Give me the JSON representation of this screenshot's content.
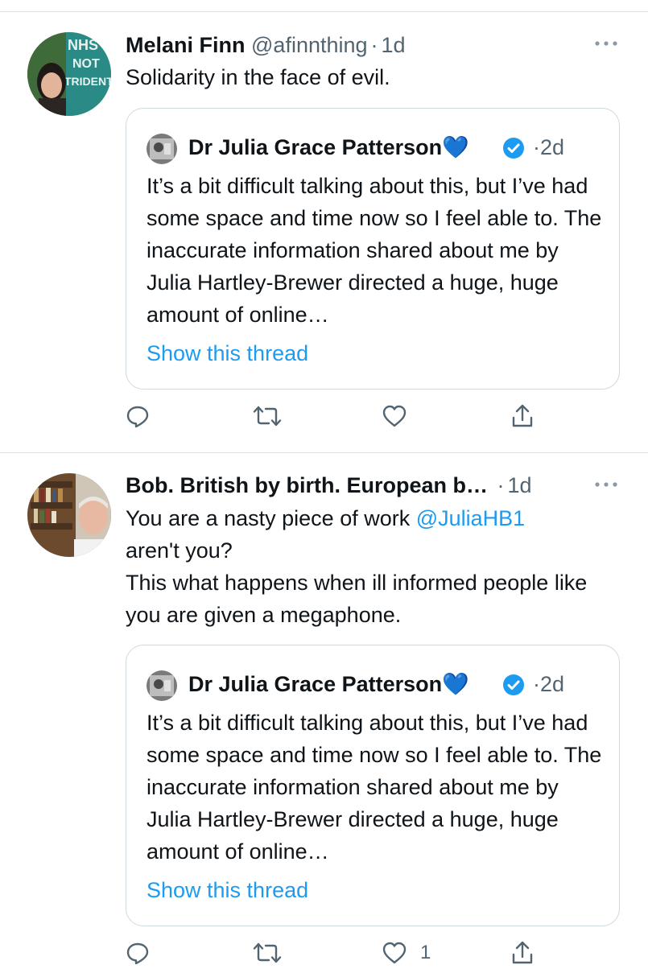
{
  "tweets": [
    {
      "name": "Melani Finn",
      "handle": "@afinnthing",
      "dot": "·",
      "time": "1d",
      "text_lines": [
        "Solidarity in the face of evil."
      ],
      "quote": {
        "name": "Dr Julia Grace Patterson💙",
        "dot": "·",
        "time": "2d",
        "text": "It’s a bit difficult talking about this, but I’ve had some space and time now so I feel able to. The inaccurate information shared about me by Julia Hartley-Brewer directed a huge, huge amount of online…",
        "link": "Show this thread"
      },
      "actions": {
        "reply": "",
        "retweet": "",
        "like": "",
        "share": ""
      }
    },
    {
      "name": "Bob. British by birth. European b…",
      "handle": "",
      "dot": "·",
      "time": "1d",
      "text_pre": "You are a nasty piece of work ",
      "mention": "@JuliaHB1",
      "text_post": "aren't you?",
      "text_rest": "This what happens when ill informed people like you are given a megaphone.",
      "quote": {
        "name": "Dr Julia Grace Patterson💙",
        "dot": "·",
        "time": "2d",
        "text": "It’s a bit difficult talking about this, but I’ve had some space and time now so I feel able to. The inaccurate information shared about me by Julia Hartley-Brewer directed a huge, huge amount of online…",
        "link": "Show this thread"
      },
      "actions": {
        "reply": "",
        "retweet": "",
        "like": "1",
        "share": ""
      }
    }
  ],
  "colors": {
    "accent": "#1d9bf0",
    "muted": "#536471",
    "verified": "#1d9bf0",
    "heart_emoji": "#1d7cf2"
  },
  "icons": [
    "more-icon",
    "reply-icon",
    "retweet-icon",
    "like-icon",
    "share-icon",
    "verified-badge-icon"
  ]
}
